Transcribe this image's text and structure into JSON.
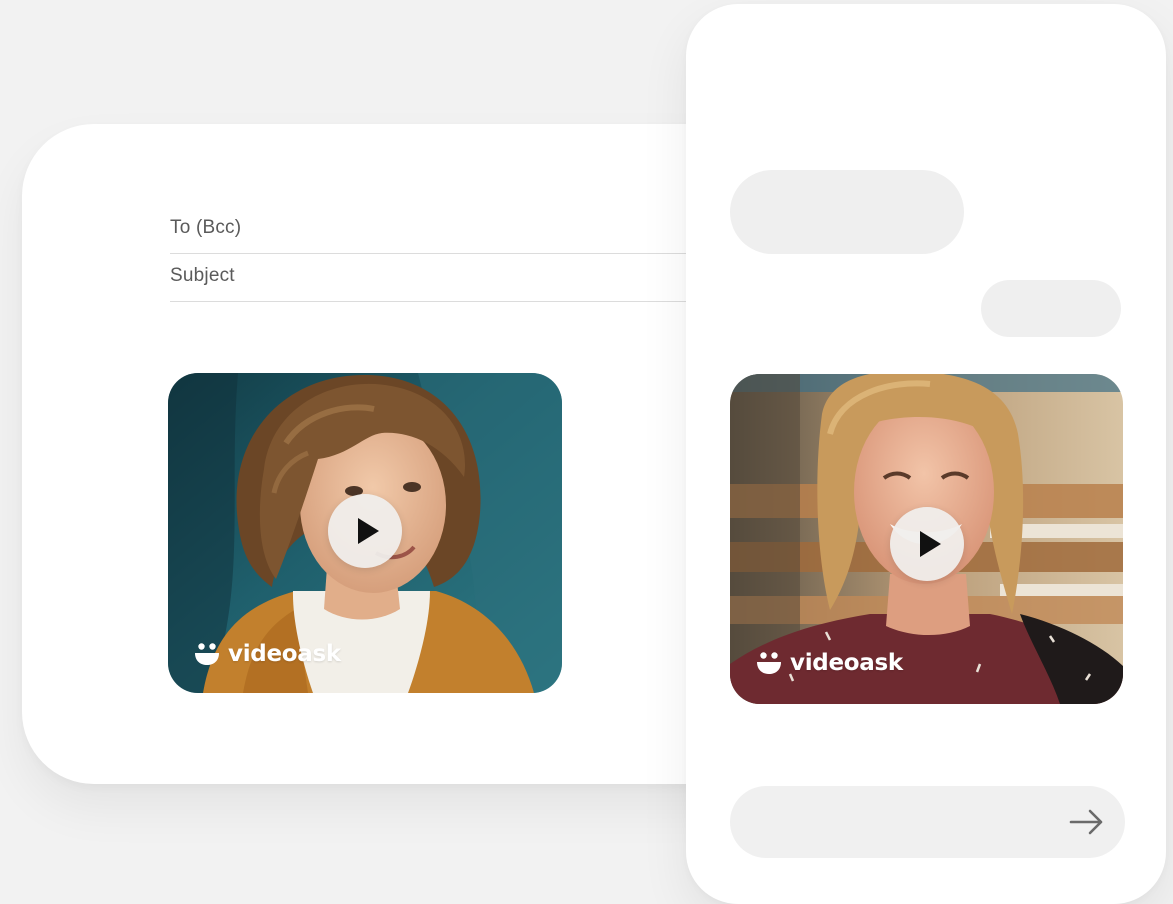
{
  "email": {
    "to_label": "To (Bcc)",
    "subject_label": "Subject",
    "video": {
      "brand": "videoask",
      "play_icon": "play-icon"
    }
  },
  "phone": {
    "video": {
      "brand": "videoask",
      "play_icon": "play-icon"
    },
    "send_icon": "arrow-right-icon"
  },
  "colors": {
    "background": "#f2f2f2",
    "card": "#ffffff",
    "bubble": "#efefef",
    "text_muted": "#5a5a5a",
    "brand_text": "#ffffff"
  }
}
